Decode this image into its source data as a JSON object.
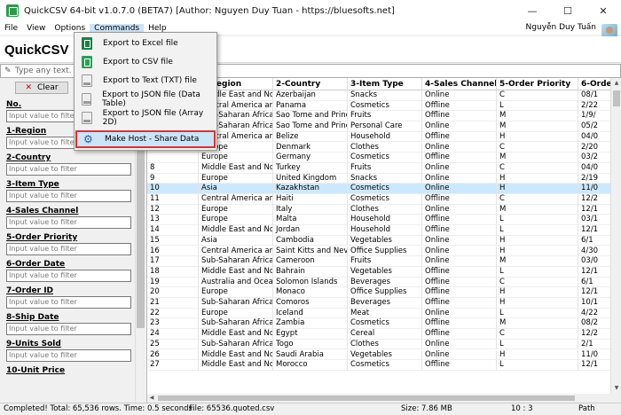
{
  "titlebar": {
    "title": "QuickCSV 64-bit v1.0.7.0 (BETA7) [Author: Nguyen Duy Tuan - https://bluesofts.net]",
    "minimize": "—",
    "maximize": "☐",
    "close": "✕"
  },
  "menubar": {
    "items": [
      "File",
      "View",
      "Options",
      "Commands",
      "Help"
    ],
    "user": "Nguyễn Duy Tuấn"
  },
  "brand": {
    "name": "QuickCSV",
    "tagline": "W"
  },
  "search": {
    "placeholder": "Type any text. Pres"
  },
  "left": {
    "clear_label": "Clear",
    "filters": [
      {
        "label": "No.",
        "placeholder": "Input value to filter"
      },
      {
        "label": "1-Region",
        "placeholder": "Input value to filter"
      },
      {
        "label": "2-Country",
        "placeholder": "Input value to filter"
      },
      {
        "label": "3-Item Type",
        "placeholder": "Input value to filter"
      },
      {
        "label": "4-Sales Channel",
        "placeholder": "Input value to filter"
      },
      {
        "label": "5-Order Priority",
        "placeholder": "Input value to filter"
      },
      {
        "label": "6-Order Date",
        "placeholder": "Input value to filter"
      },
      {
        "label": "7-Order ID",
        "placeholder": "Input value to filter"
      },
      {
        "label": "8-Ship Date",
        "placeholder": "Input value to filter"
      },
      {
        "label": "9-Units Sold",
        "placeholder": "Input value to filter"
      },
      {
        "label": "10-Unit Price",
        "placeholder": ""
      }
    ]
  },
  "grid": {
    "headers": [
      "",
      "1-Region",
      "2-Country",
      "3-Item Type",
      "4-Sales Channel",
      "5-Order Priority",
      "6-Order D"
    ],
    "rows": [
      [
        "",
        "Middle East and No...",
        "Azerbaijan",
        "Snacks",
        "Online",
        "C",
        "08/1"
      ],
      [
        "",
        "Central America an...",
        "Panama",
        "Cosmetics",
        "Offline",
        "L",
        "2/22"
      ],
      [
        "",
        "Sub-Saharan Africa",
        "Sao Tome and Princ...",
        "Fruits",
        "Offline",
        "M",
        "1/9/"
      ],
      [
        "",
        "Sub-Saharan Africa",
        "Sao Tome and Princ...",
        "Personal Care",
        "Online",
        "M",
        "05/2"
      ],
      [
        "",
        "Central America an...",
        "Belize",
        "Household",
        "Offline",
        "H",
        "04/0"
      ],
      [
        "",
        "Europe",
        "Denmark",
        "Clothes",
        "Online",
        "C",
        "2/20"
      ],
      [
        "",
        "Europe",
        "Germany",
        "Cosmetics",
        "Offline",
        "M",
        "03/2"
      ],
      [
        "8",
        "Middle East and No...",
        "Turkey",
        "Fruits",
        "Online",
        "C",
        "04/0"
      ],
      [
        "9",
        "Europe",
        "United Kingdom",
        "Snacks",
        "Online",
        "H",
        "2/19"
      ],
      [
        "10",
        "Asia",
        "Kazakhstan",
        "Cosmetics",
        "Online",
        "H",
        "11/0"
      ],
      [
        "11",
        "Central America an...",
        "Haiti",
        "Cosmetics",
        "Offline",
        "C",
        "12/2"
      ],
      [
        "12",
        "Europe",
        "Italy",
        "Clothes",
        "Online",
        "M",
        "12/1"
      ],
      [
        "13",
        "Europe",
        "Malta",
        "Household",
        "Offline",
        "L",
        "03/1"
      ],
      [
        "14",
        "Middle East and No...",
        "Jordan",
        "Household",
        "Offline",
        "L",
        "12/1"
      ],
      [
        "15",
        "Asia",
        "Cambodia",
        "Vegetables",
        "Online",
        "H",
        "6/1"
      ],
      [
        "16",
        "Central America an...",
        "Saint Kitts and Nevis",
        "Office Supplies",
        "Online",
        "H",
        "4/30"
      ],
      [
        "17",
        "Sub-Saharan Africa",
        "Cameroon",
        "Fruits",
        "Online",
        "M",
        "03/0"
      ],
      [
        "18",
        "Middle East and No...",
        "Bahrain",
        "Vegetables",
        "Offline",
        "L",
        "12/1"
      ],
      [
        "19",
        "Australia and Oceania",
        "Solomon Islands",
        "Beverages",
        "Offline",
        "C",
        "6/1"
      ],
      [
        "20",
        "Europe",
        "Monaco",
        "Office Supplies",
        "Offline",
        "H",
        "12/1"
      ],
      [
        "21",
        "Sub-Saharan Africa",
        "Comoros",
        "Beverages",
        "Offline",
        "H",
        "10/1"
      ],
      [
        "22",
        "Europe",
        "Iceland",
        "Meat",
        "Online",
        "L",
        "4/22"
      ],
      [
        "23",
        "Sub-Saharan Africa",
        "Zambia",
        "Cosmetics",
        "Offline",
        "M",
        "08/2"
      ],
      [
        "24",
        "Middle East and No...",
        "Egypt",
        "Cereal",
        "Offline",
        "C",
        "12/2"
      ],
      [
        "25",
        "Sub-Saharan Africa",
        "Togo",
        "Clothes",
        "Online",
        "L",
        "2/1"
      ],
      [
        "26",
        "Middle East and No...",
        "Saudi Arabia",
        "Vegetables",
        "Online",
        "H",
        "11/0"
      ],
      [
        "27",
        "Middle East and No...",
        "Morocco",
        "Cosmetics",
        "Offline",
        "L",
        "12/1"
      ]
    ],
    "selected_row": 9
  },
  "status": {
    "completed": "Completed! Total: 65,536 rows. Time: 0.5 seconds",
    "file": "File: 65536.quoted.csv",
    "size": "Size: 7.86 MB",
    "position": "10 : 3",
    "path": "Path"
  },
  "commands_menu": {
    "items": [
      {
        "label": "Export to Excel file",
        "icon": "excel-icon"
      },
      {
        "label": "Export to CSV file",
        "icon": "csv-icon"
      },
      {
        "label": "Export to Text (TXT) file",
        "icon": "txt-icon"
      },
      {
        "label": "Export to JSON file (Data Table)",
        "icon": "json-icon"
      },
      {
        "label": "Export to JSON file (Array 2D)",
        "icon": "json-icon"
      },
      {
        "label": "Make Host - Share Data",
        "icon": "host-share-icon"
      }
    ],
    "highlighted": 5,
    "highlight_color": "#e03030"
  }
}
